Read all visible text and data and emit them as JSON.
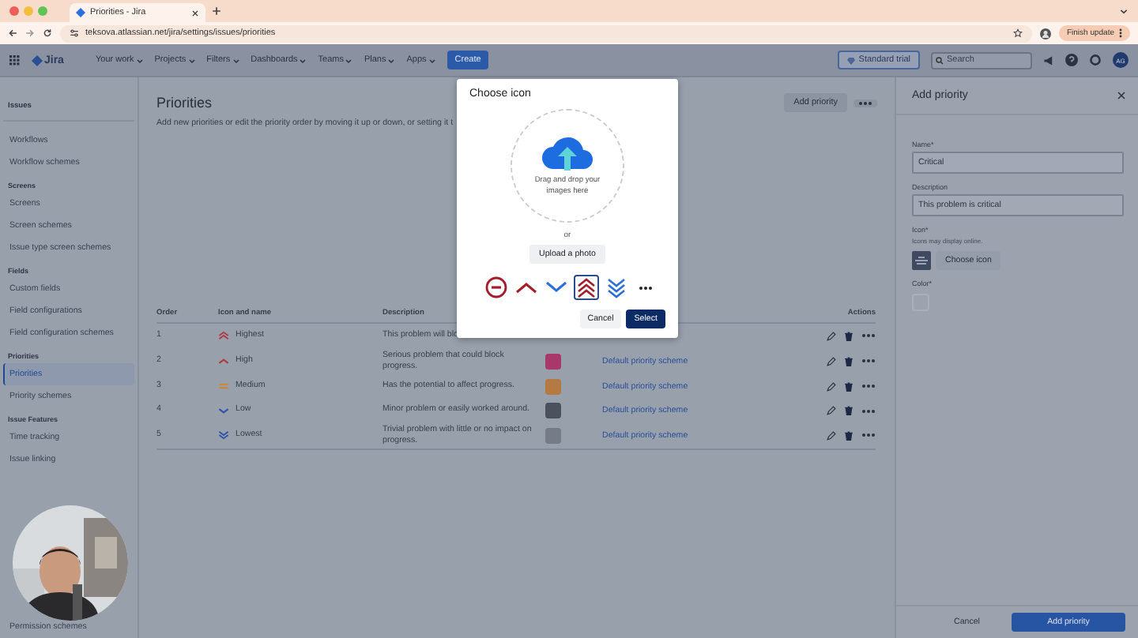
{
  "browser": {
    "tab_title": "Priorities - Jira",
    "url": "teksova.atlassian.net/jira/settings/issues/priorities",
    "update_button": "Finish update"
  },
  "nav": {
    "product": "Jira",
    "items": [
      "Your work",
      "Projects",
      "Filters",
      "Dashboards",
      "Teams",
      "Plans",
      "Apps"
    ],
    "create": "Create",
    "trial": "Standard trial",
    "search": {
      "placeholder": "Search"
    },
    "avatar": "AG"
  },
  "sidebar": {
    "heading": "Issues",
    "sections": [
      {
        "items": [
          {
            "label": "Workflows",
            "selected": false
          },
          {
            "label": "Workflow schemes",
            "selected": false
          }
        ]
      },
      {
        "title": "Screens",
        "items": [
          {
            "label": "Screens",
            "selected": false
          },
          {
            "label": "Screen schemes",
            "selected": false
          },
          {
            "label": "Issue type screen schemes",
            "selected": false
          }
        ]
      },
      {
        "title": "Fields",
        "items": [
          {
            "label": "Custom fields",
            "selected": false
          },
          {
            "label": "Field configurations",
            "selected": false
          },
          {
            "label": "Field configuration schemes",
            "selected": false
          }
        ]
      },
      {
        "title": "Priorities",
        "items": [
          {
            "label": "Priorities",
            "selected": true
          },
          {
            "label": "Priority schemes",
            "selected": false
          }
        ]
      },
      {
        "title": "Issue Features",
        "items": [
          {
            "label": "Time tracking",
            "selected": false
          },
          {
            "label": "Issue linking",
            "selected": false
          }
        ]
      }
    ],
    "bottom_item": {
      "label": "Permission schemes",
      "selected": false
    }
  },
  "page": {
    "title": "Priorities",
    "description": "Add new priorities or edit the priority order by moving it up or down, or setting it t",
    "add_button": "Add priority"
  },
  "table": {
    "columns": [
      "Order",
      "Icon and name",
      "Description",
      "Actions"
    ],
    "rows": [
      {
        "order": "1",
        "name": "Highest",
        "description": "This problem will blo"
      },
      {
        "order": "2",
        "name": "High",
        "description": "Serious problem that could block progress.",
        "color": "#a8386a",
        "scheme": "Default priority scheme"
      },
      {
        "order": "3",
        "name": "Medium",
        "description": "Has the potential to affect progress.",
        "color": "#b47a42",
        "scheme": "Default priority scheme"
      },
      {
        "order": "4",
        "name": "Low",
        "description": "Minor problem or easily worked around.",
        "color": "#4b515d",
        "scheme": "Default priority scheme"
      },
      {
        "order": "5",
        "name": "Lowest",
        "description": "Trivial problem with little or no impact on progress.",
        "color": "#767c87",
        "scheme": "Default priority scheme"
      }
    ]
  },
  "dialog": {
    "title": "Choose icon",
    "drop_text": "Drag and drop your images here",
    "or": "or",
    "upload": "Upload a photo",
    "choices": [
      {
        "selected": false
      },
      {
        "selected": false
      },
      {
        "selected": false
      },
      {
        "selected": true
      },
      {
        "selected": false
      }
    ],
    "cancel": "Cancel",
    "select": "Select"
  },
  "panel": {
    "title": "Add priority",
    "name_label": "Name*",
    "name_value": "Critical",
    "description_label": "Description",
    "description_value": "This problem is critical",
    "icon_label": "Icon*",
    "icon_hint": "Icons may display online.",
    "choose_icon": "Choose icon",
    "color_label": "Color*",
    "cancel": "Cancel",
    "submit": "Add priority"
  }
}
